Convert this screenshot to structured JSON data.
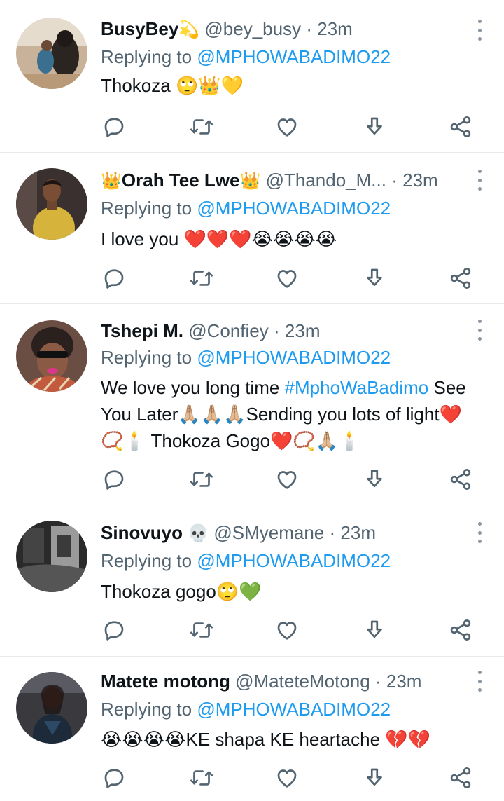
{
  "colors": {
    "link": "#1d9bf0",
    "secondary": "#536471",
    "text": "#0f1419",
    "divider": "#e7e9ea"
  },
  "icons": {
    "reply": "reply-icon",
    "retweet": "retweet-icon",
    "like": "heart-icon",
    "download": "download-icon",
    "share": "share-icon",
    "more": "more-options-icon"
  },
  "tweets": [
    {
      "name": "BusyBey",
      "name_suffix": "💫",
      "handle": "@bey_busy",
      "sep": "·",
      "time": "23m",
      "replying_label": "Replying to",
      "replying_to": "@MPHOWABADIMO22",
      "text": "Thokoza 🙄👑💛"
    },
    {
      "name_prefix": "👑",
      "name": "Orah Tee Lwe",
      "name_suffix": "👑",
      "handle": "@Thando_M...",
      "sep": "·",
      "time": "23m",
      "replying_label": "Replying to",
      "replying_to": "@MPHOWABADIMO22",
      "text": "I love you ❤️❤️❤️😭😭😭😭"
    },
    {
      "name": "Tshepi M.",
      "handle": "@Confiey",
      "sep": "·",
      "time": "23m",
      "replying_label": "Replying to",
      "replying_to": "@MPHOWABADIMO22",
      "text_before_hashtag": "We love you long time ",
      "hashtag": "#MphoWaBadimo",
      "text_after_hashtag": " See You Later🙏🏼🙏🏼🙏🏼Sending you lots of light❤️📿🕯️ Thokoza Gogo❤️📿🙏🏼🕯️"
    },
    {
      "name": "Sinovuyo",
      "name_suffix": "💀",
      "handle": "@SMyemane",
      "sep": "·",
      "time": "23m",
      "replying_label": "Replying to",
      "replying_to": "@MPHOWABADIMO22",
      "text": "Thokoza gogo🙄💚"
    },
    {
      "name": "Matete motong",
      "handle": "@MateteMotong",
      "sep": "·",
      "time": "23m",
      "replying_label": "Replying to",
      "replying_to": "@MPHOWABADIMO22",
      "text": "😭😭😭😭KE shapa KE heartache 💔💔"
    }
  ]
}
